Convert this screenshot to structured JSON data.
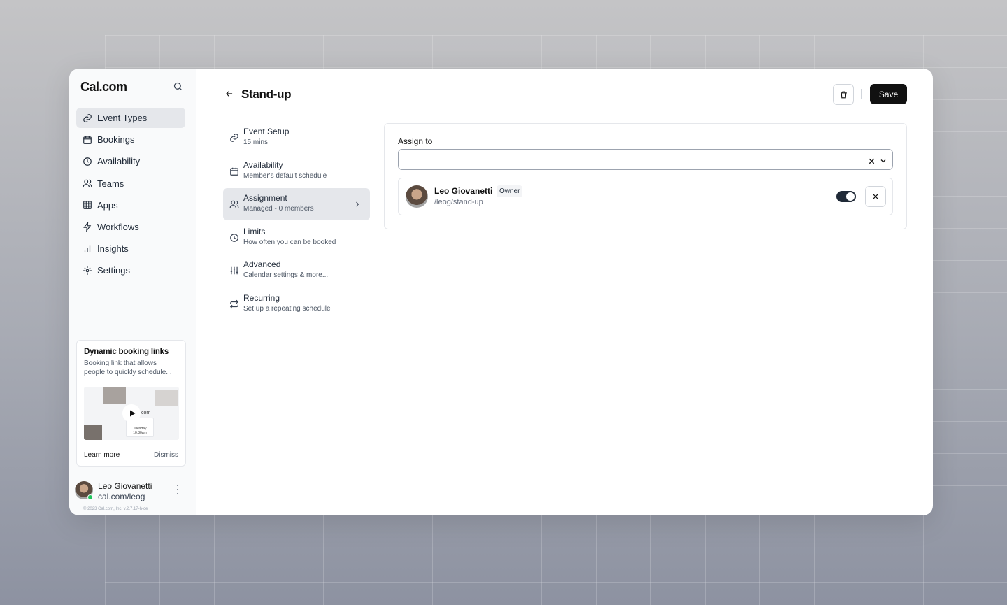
{
  "sidebar": {
    "logo": "Cal.com",
    "items": [
      {
        "label": "Event Types",
        "icon": "link-icon",
        "active": true
      },
      {
        "label": "Bookings",
        "icon": "calendar-icon"
      },
      {
        "label": "Availability",
        "icon": "clock-icon"
      },
      {
        "label": "Teams",
        "icon": "users-icon"
      },
      {
        "label": "Apps",
        "icon": "grid-icon"
      },
      {
        "label": "Workflows",
        "icon": "zap-icon"
      },
      {
        "label": "Insights",
        "icon": "bar-chart-icon"
      },
      {
        "label": "Settings",
        "icon": "gear-icon"
      }
    ],
    "promo": {
      "title": "Dynamic booking links",
      "description": "Booking link that allows people to quickly schedule...",
      "video_text_brand": "com",
      "video_text_day": "Tuesday",
      "video_text_time": "10:30am",
      "learn_more": "Learn more",
      "dismiss": "Dismiss"
    },
    "user": {
      "name": "Leo Giovanetti",
      "handle": "cal.com/leog",
      "status_color": "#22c55e"
    },
    "copyright": "© 2023 Cal.com, Inc. v.2.7.17-h-ce"
  },
  "header": {
    "title": "Stand-up",
    "save_label": "Save"
  },
  "subnav": [
    {
      "title": "Event Setup",
      "subtitle": "15 mins",
      "icon": "link-icon"
    },
    {
      "title": "Availability",
      "subtitle": "Member's default schedule",
      "icon": "calendar-icon"
    },
    {
      "title": "Assignment",
      "subtitle": "Managed - 0 members",
      "icon": "users-icon",
      "active": true
    },
    {
      "title": "Limits",
      "subtitle": "How often you can be booked",
      "icon": "clock-icon"
    },
    {
      "title": "Advanced",
      "subtitle": "Calendar settings & more...",
      "icon": "sliders-icon"
    },
    {
      "title": "Recurring",
      "subtitle": "Set up a repeating schedule",
      "icon": "repeat-icon"
    }
  ],
  "assignment": {
    "label": "Assign to",
    "select_value": "",
    "member": {
      "name": "Leo Giovanetti",
      "role": "Owner",
      "path": "/leog/stand-up",
      "enabled": true
    }
  }
}
